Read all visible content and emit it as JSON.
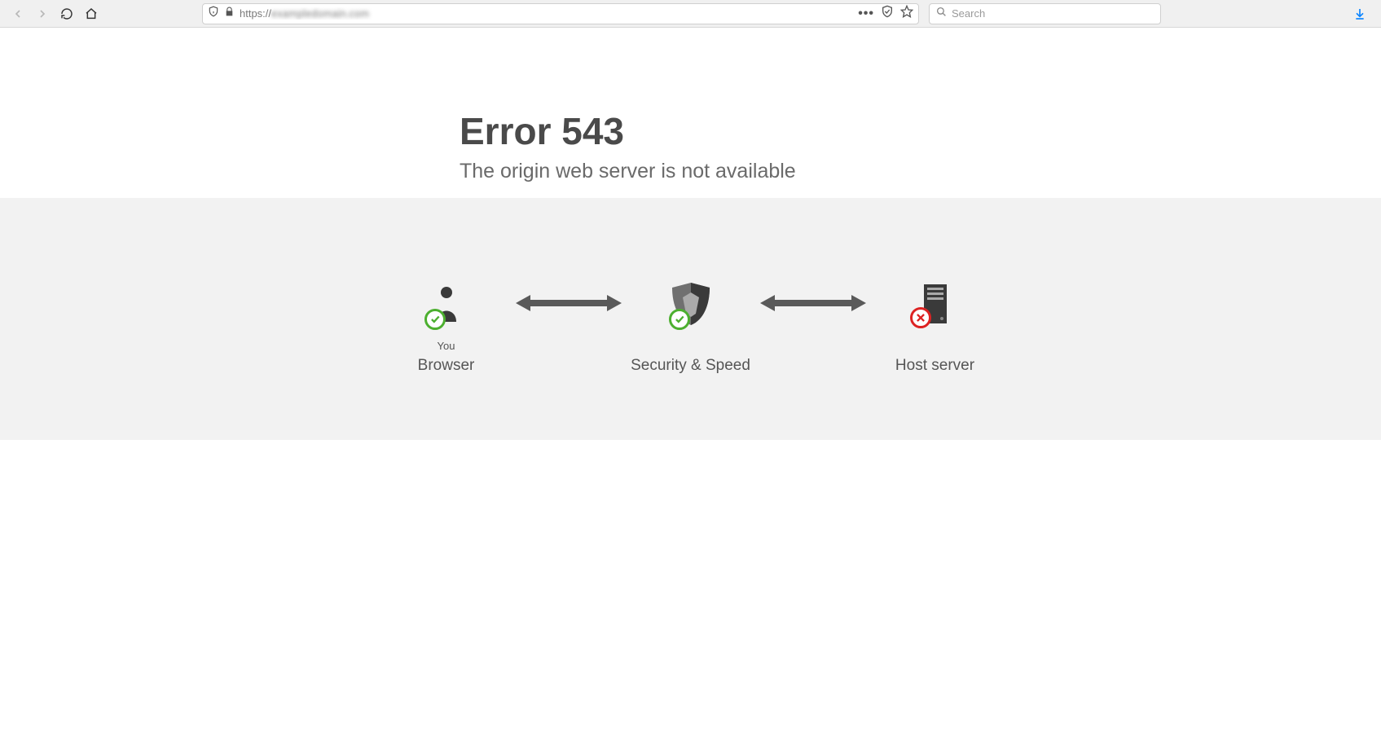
{
  "toolbar": {
    "url_prefix": "https://",
    "search_placeholder": "Search"
  },
  "error": {
    "title": "Error 543",
    "subtitle": "The origin web server is not available"
  },
  "diagram": {
    "node1": {
      "top": "You",
      "bottom": "Browser",
      "status": "ok"
    },
    "node2": {
      "top": "",
      "bottom": "Security & Speed",
      "status": "ok"
    },
    "node3": {
      "top": "",
      "bottom": "Host server",
      "status": "error"
    }
  }
}
